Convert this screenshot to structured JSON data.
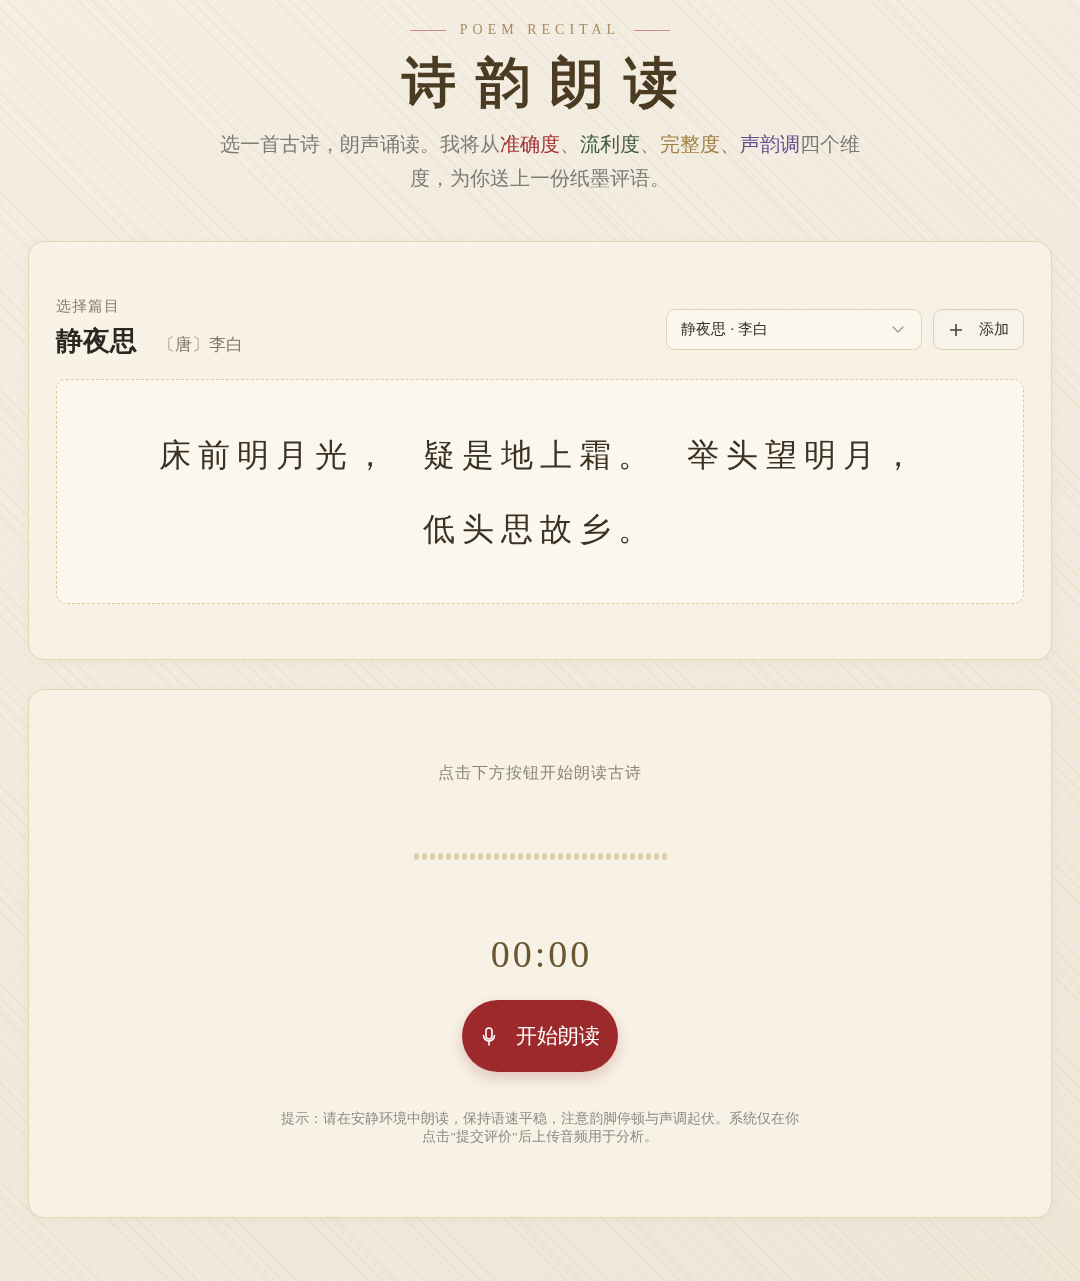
{
  "header": {
    "eyebrow": "POEM RECITAL",
    "title": "诗韵朗读",
    "intro": [
      {
        "text": "选一首古诗，朗声诵读。我将从"
      },
      {
        "text": "准确度",
        "color": "#a33434"
      },
      {
        "text": "、"
      },
      {
        "text": "流利度",
        "color": "#3f5b3f"
      },
      {
        "text": "、"
      },
      {
        "text": "完整度",
        "color": "#a08042"
      },
      {
        "text": "、"
      },
      {
        "text": "声韵调",
        "color": "#6a4c8c"
      },
      {
        "text": "四个维度，为你送上一份纸墨评语。"
      }
    ]
  },
  "poem_panel": {
    "label": "选择篇目",
    "poem_title": "静夜思",
    "author": "〔唐〕李白",
    "poem_select": {
      "value": "静夜思 · 李白"
    },
    "add_button": "添加",
    "verses": [
      "床前明月光，",
      "疑是地上霜。",
      "举头望明月，",
      "低头思故乡。"
    ]
  },
  "recorder": {
    "prompt": "点击下方按钮开始朗读古诗",
    "timer": "00:00",
    "record_button": "开始朗读",
    "hint": "提示：请在安静环境中朗读，保持语速平稳，注意韵脚停顿与声调起伏。系统仅在你点击\"提交评价\"后上传音频用于分析。"
  }
}
